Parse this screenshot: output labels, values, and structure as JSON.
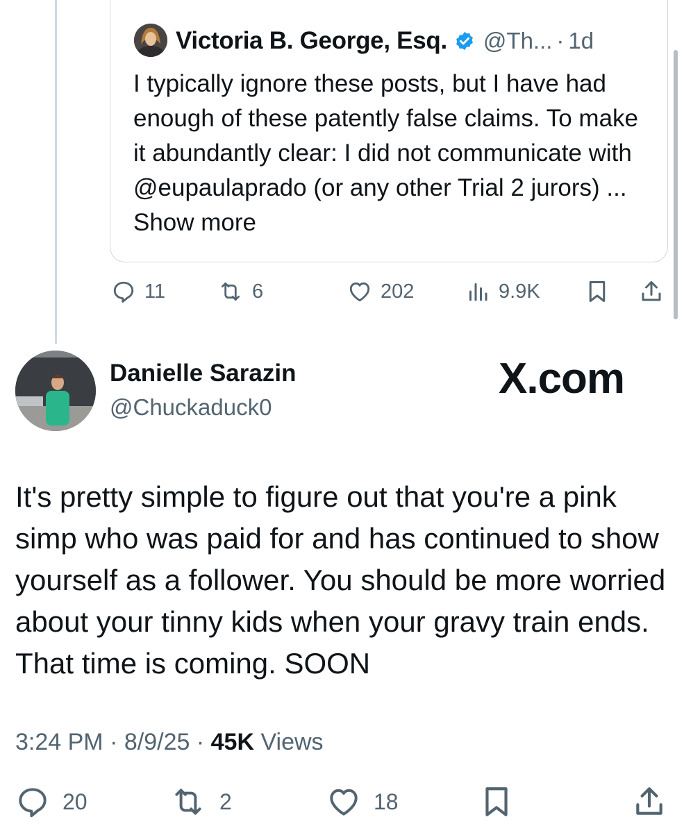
{
  "quoted_tweet": {
    "author_name": "Victoria B. George, Esq.",
    "author_handle": "@Th...",
    "separator": "·",
    "time_ago": "1d",
    "verified": true,
    "text": "I typically ignore these posts, but I have had enough of these patently false claims. To make it abundantly clear: I did not communicate with @eupaulaprado (or any other Trial 2 jurors) ...",
    "show_more": "Show more",
    "stats": {
      "replies": "11",
      "reposts": "6",
      "likes": "202",
      "views": "9.9K"
    }
  },
  "main_tweet": {
    "author_name": "Danielle Sarazin",
    "author_handle": "@Chuckaduck0",
    "watermark": "X.com",
    "text": "It's pretty simple to figure out that you're a pink simp who was paid for and has continued to show yourself as a follower.  You should be more worried about your tinny kids when your gravy train ends.  That time is coming.  SOON",
    "time": "3:24 PM",
    "date": "8/9/25",
    "views_count": "45K",
    "views_label": "Views",
    "dot": "·",
    "stats": {
      "replies": "20",
      "reposts": "2",
      "likes": "18"
    }
  },
  "colors": {
    "text": "#0f1419",
    "muted": "#536471",
    "border": "#cfd9de",
    "verified": "#1d9bf0"
  },
  "icons": [
    "reply-icon",
    "repost-icon",
    "like-icon",
    "views-icon",
    "bookmark-icon",
    "share-icon",
    "verified-badge-icon"
  ]
}
